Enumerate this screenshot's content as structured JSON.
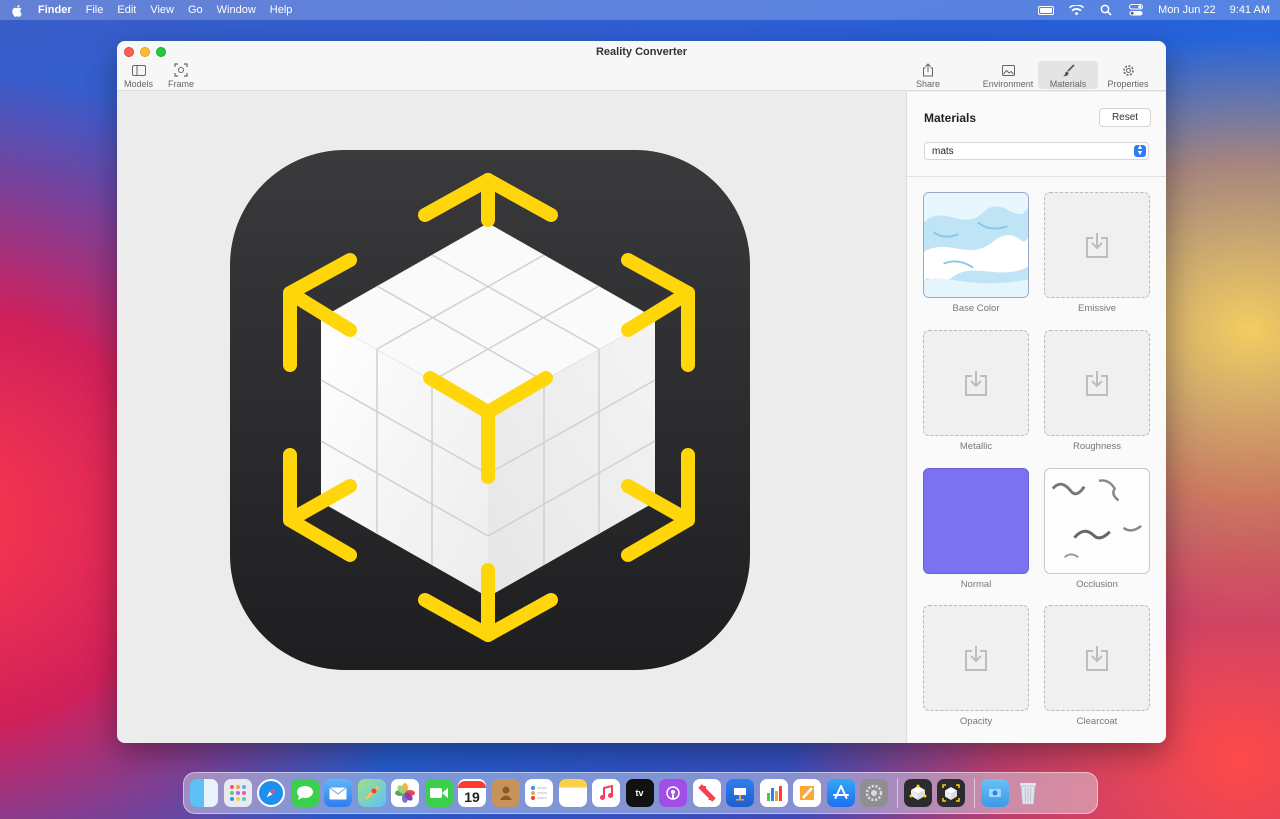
{
  "menubar": {
    "apple_icon": "apple-logo-icon",
    "items": [
      "Finder",
      "File",
      "Edit",
      "View",
      "Go",
      "Window",
      "Help"
    ],
    "date": "Mon Jun 22",
    "time": "9:41 AM",
    "status_icons": [
      "battery-icon",
      "wifi-icon",
      "spotlight-search-icon",
      "control-center-icon"
    ]
  },
  "window": {
    "title": "Reality Converter",
    "toolbar": {
      "models_label": "Models",
      "frame_label": "Frame",
      "share_label": "Share",
      "environment_label": "Environment",
      "materials_label": "Materials",
      "properties_label": "Properties"
    }
  },
  "sidebar": {
    "title": "Materials",
    "reset_label": "Reset",
    "material_select_value": "mats",
    "slots": [
      {
        "label": "Base Color",
        "state": "texture-snow"
      },
      {
        "label": "Emissive",
        "state": "empty"
      },
      {
        "label": "Metallic",
        "state": "empty"
      },
      {
        "label": "Roughness",
        "state": "empty"
      },
      {
        "label": "Normal",
        "state": "texture-normal"
      },
      {
        "label": "Occlusion",
        "state": "texture-occlusion"
      },
      {
        "label": "Opacity",
        "state": "empty"
      },
      {
        "label": "Clearcoat",
        "state": "empty"
      }
    ]
  },
  "viewport": {
    "model_icon": "reality-converter-cube-icon"
  },
  "dock": {
    "calendar_day": "19",
    "apps": [
      "finder-icon",
      "launchpad-icon",
      "safari-icon",
      "messages-icon",
      "mail-icon",
      "maps-icon",
      "photos-icon",
      "facetime-icon",
      "calendar-icon",
      "contacts-icon",
      "reminders-icon",
      "notes-icon",
      "music-icon",
      "tv-icon",
      "podcasts-icon",
      "news-icon",
      "keynote-icon",
      "numbers-icon",
      "pages-icon",
      "app-store-icon",
      "system-preferences-icon",
      "reality-composer-icon",
      "reality-converter-icon",
      "downloads-folder-icon",
      "trash-icon"
    ]
  },
  "colors": {
    "accent_blue": "#2f7cf6",
    "arrow_yellow": "#ffd60a",
    "icon_dark": "#2c2c2e",
    "normal_map": "#7a72f0"
  }
}
